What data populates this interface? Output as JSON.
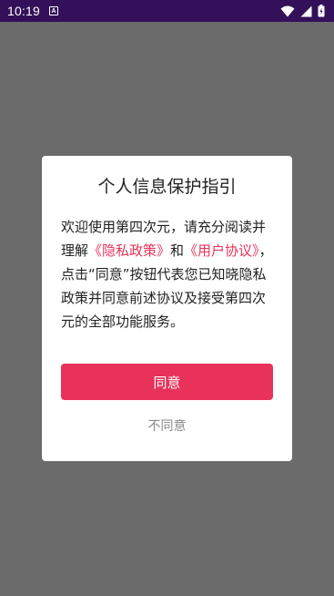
{
  "status_bar": {
    "time": "10:19",
    "notification_glyph": "A",
    "icons": [
      "wifi-icon",
      "signal-icon",
      "battery-icon"
    ]
  },
  "dialog": {
    "title": "个人信息保护指引",
    "body": {
      "part1": "欢迎使用第四次元，请充分阅读并理解",
      "privacy_link": "《隐私政策》",
      "part2": "和",
      "user_agreement_link": "《用户协议》",
      "part3": "，点击“同意”按钮代表您已知晓隐私政策并同意前述协议及接受第四次元的全部功能服务。"
    },
    "agree_label": "同意",
    "disagree_label": "不同意"
  },
  "colors": {
    "accent": "#e8325a",
    "status_bar": "#34105a",
    "scrim": "#6b6b6b"
  }
}
